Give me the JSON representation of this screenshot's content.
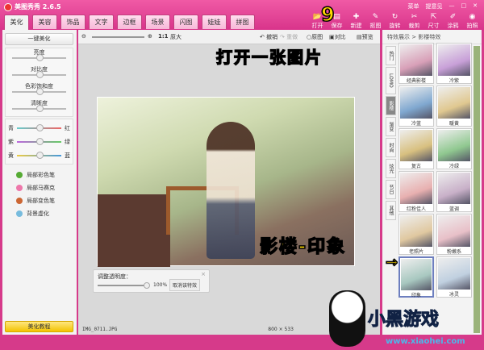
{
  "app": {
    "title": "美图秀秀 2.6.5",
    "menu": "菜单",
    "feedback": "提意见",
    "min": "—",
    "max": "□",
    "close": "✕"
  },
  "tabs": [
    "美化",
    "美容",
    "饰品",
    "文字",
    "边框",
    "场景",
    "闪图",
    "娃娃",
    "拼图"
  ],
  "tools": [
    {
      "label": "打开",
      "icon": "📂"
    },
    {
      "label": "保存",
      "icon": "▤"
    },
    {
      "label": "新建",
      "icon": "✚"
    },
    {
      "label": "抠图",
      "icon": "✎"
    },
    {
      "label": "旋转",
      "icon": "↻"
    },
    {
      "label": "裁剪",
      "icon": "✂"
    },
    {
      "label": "尺寸",
      "icon": "⇱"
    },
    {
      "label": "涂鸦",
      "icon": "✐"
    },
    {
      "label": "拍照",
      "icon": "◉"
    }
  ],
  "left": {
    "one_click": "一键美化",
    "sliders": [
      "亮度",
      "对比度",
      "色彩饱和度",
      "清晰度"
    ],
    "color_sliders": [
      {
        "l": "青",
        "r": "红"
      },
      {
        "l": "紫",
        "r": "绿"
      },
      {
        "l": "黄",
        "r": "蓝"
      }
    ],
    "tools": [
      "局部彩色笔",
      "局部马赛克",
      "局部变色笔",
      "背景虚化"
    ],
    "tutorial": "美化教程"
  },
  "canvas": {
    "zoom_label": "1:1",
    "original_size": "原大",
    "undo": "撤销",
    "redo": "重做",
    "original": "原图",
    "compare": "对比",
    "preview": "预览",
    "filename": "IMG_0711.JPG",
    "dimensions": "800 × 533"
  },
  "opacity": {
    "title": "调整透明度：",
    "value": "100%",
    "cancel": "取消该特效",
    "value_num": 100
  },
  "right": {
    "breadcrumb": "特效展示 > 影楼特效",
    "side_tabs": [
      "热门",
      "LOMO",
      "影楼",
      "渐变",
      "时尚",
      "炫光",
      "节日",
      "其他"
    ],
    "effects": [
      "经典影楼",
      "冷紫",
      "冷蓝",
      "暖黄",
      "复古",
      "冷绿",
      "红粉佳人",
      "蓝调",
      "老照片",
      "粉嫩系",
      "印象",
      "冰灵"
    ],
    "selected": "印象"
  },
  "annotations": {
    "open": "打开一张图片",
    "effect": "影楼-印象"
  },
  "watermark": {
    "name": "小黑游戏",
    "url": "www.xiaohei.com"
  }
}
